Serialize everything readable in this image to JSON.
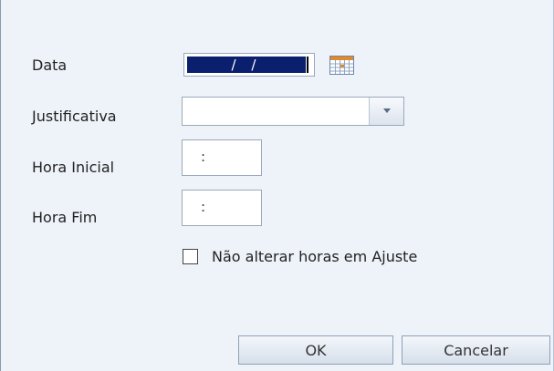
{
  "form": {
    "date_label": "Data",
    "date_value": "/ /",
    "calendar_icon": "calendar-icon",
    "justificativa_label": "Justificativa",
    "justificativa_value": "",
    "dropdown_icon": "chevron-down-icon",
    "hora_inicial_label": "Hora Inicial",
    "hora_inicial_value": ":",
    "hora_fim_label": "Hora Fim",
    "hora_fim_value": ":",
    "checkbox_label": "Não alterar horas em Ajuste",
    "checkbox_checked": false
  },
  "buttons": {
    "ok_label": "OK",
    "cancel_label": "Cancelar"
  },
  "colors": {
    "dialog_background": "#eef3fa",
    "selection": "#0a1f6e",
    "border": "#9aa9bb"
  }
}
